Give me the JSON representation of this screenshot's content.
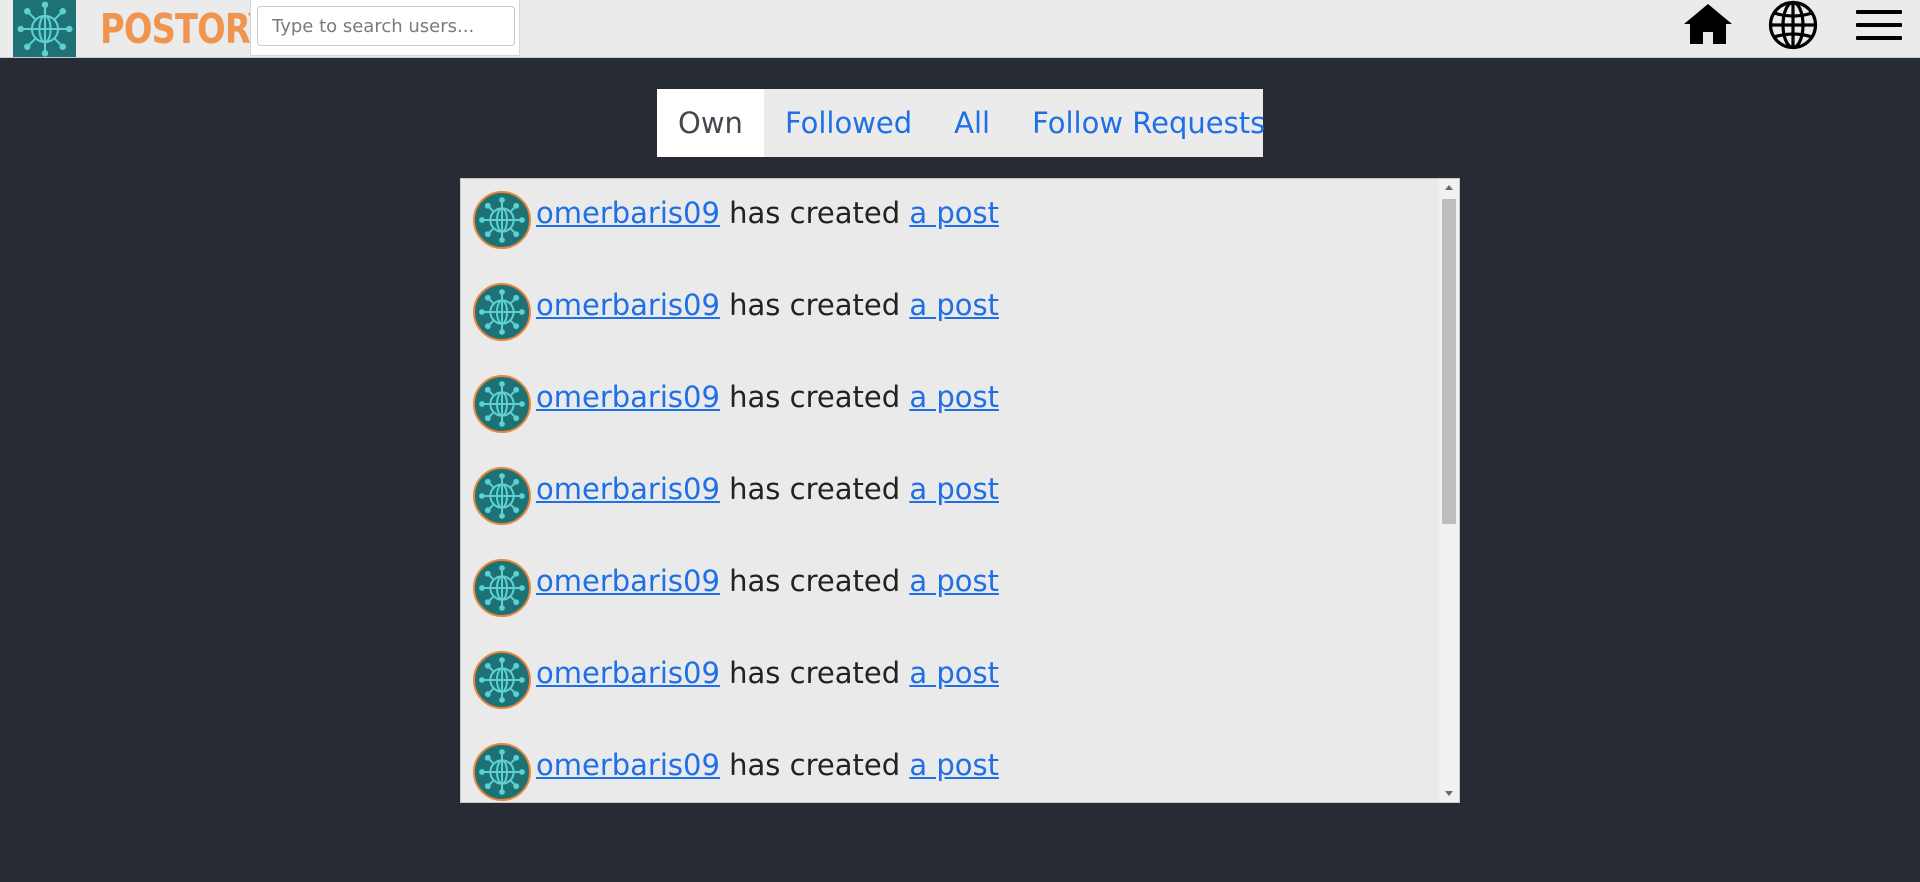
{
  "app": {
    "brand": "POSTORY",
    "logo_icon": "globe-network-icon"
  },
  "search": {
    "placeholder": "Type to search users...",
    "value": ""
  },
  "nav": {
    "icons": [
      "home-icon",
      "globe-icon",
      "menu-icon"
    ]
  },
  "tabs": [
    {
      "label": "Own",
      "active": true
    },
    {
      "label": "Followed",
      "active": false
    },
    {
      "label": "All",
      "active": false
    },
    {
      "label": "Follow Requests",
      "active": false
    }
  ],
  "feed": {
    "items": [
      {
        "username": "omerbaris09",
        "action": "has created",
        "link": "a post"
      },
      {
        "username": "omerbaris09",
        "action": "has created",
        "link": "a post"
      },
      {
        "username": "omerbaris09",
        "action": "has created",
        "link": "a post"
      },
      {
        "username": "omerbaris09",
        "action": "has created",
        "link": "a post"
      },
      {
        "username": "omerbaris09",
        "action": "has created",
        "link": "a post"
      },
      {
        "username": "omerbaris09",
        "action": "has created",
        "link": "a post"
      },
      {
        "username": "omerbaris09",
        "action": "has created",
        "link": "a post"
      }
    ]
  },
  "colors": {
    "background": "#272b33",
    "brand": "#f0954f",
    "link": "#1f6fe6",
    "logo_teal": "#1e7175",
    "avatar_ring": "#e8863a"
  }
}
